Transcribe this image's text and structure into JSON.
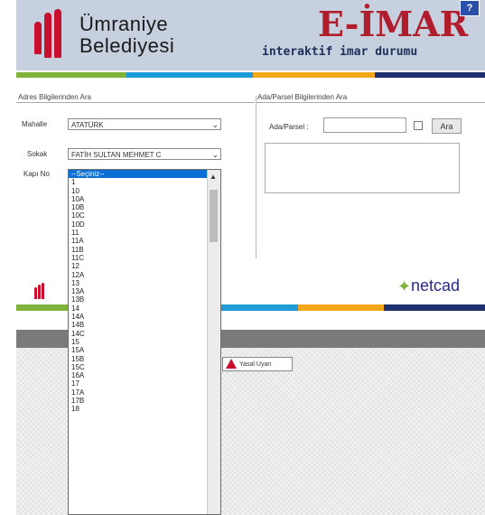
{
  "header": {
    "brand_line1": "Ümraniye",
    "brand_line2": "Belediyesi",
    "eimar_title": "E-İMAR",
    "eimar_subtitle": "interaktif imar durumu",
    "help_label": "?"
  },
  "colors": {
    "accent_red": "#c8102e",
    "stripe_green": "#7fb23b",
    "stripe_blue": "#1f9bd7",
    "stripe_orange": "#f2a71b",
    "stripe_navy": "#1e2f70",
    "selection_blue": "#0b6fd6"
  },
  "address_search": {
    "title": "Adres Bilgilerinden Ara",
    "mahalle_label": "Mahalle",
    "mahalle_value": "ATATÜRK",
    "sokak_label": "Sokak",
    "sokak_value": "FATİH SULTAN MEHMET C",
    "kapi_label": "Kapı No"
  },
  "parcel_search": {
    "title": "Ada/Parsel Bilgilerinden Ara",
    "ada_parsel_label": "Ada/Parsel :",
    "ara_button": "Ara"
  },
  "kapi_dropdown": {
    "options": [
      "--Seçiniz--",
      "1",
      "10",
      "10A",
      "10B",
      "10C",
      "10D",
      "11",
      "11A",
      "11B",
      "11C",
      "12",
      "12A",
      "13",
      "13A",
      "13B",
      "14",
      "14A",
      "14B",
      "14C",
      "15",
      "15A",
      "15B",
      "15C",
      "16A",
      "17",
      "17A",
      "17B",
      "18"
    ]
  },
  "footer": {
    "brand": "netcad",
    "warning_label": "Yasal Uyarı"
  },
  "icons": {
    "logo": "belediye-logo-icon",
    "help": "help-icon",
    "netcad": "netcad-logo-icon",
    "warning": "warning-icon",
    "chevron": "chevron-down-icon"
  }
}
